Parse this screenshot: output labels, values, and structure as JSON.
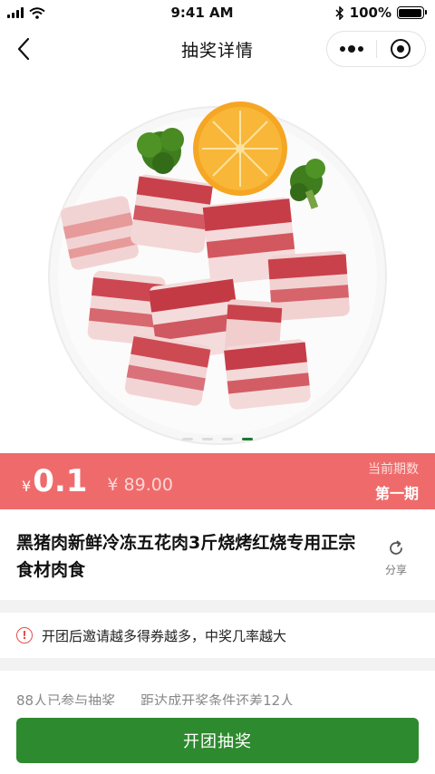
{
  "status_bar": {
    "time": "9:41 AM",
    "battery_text": "100%",
    "battery_level": 1.0
  },
  "nav": {
    "title": "抽奖详情",
    "back_icon": "chevron-left-icon",
    "more_icon": "more-dots-icon",
    "close_icon": "target-circle-icon"
  },
  "hero": {
    "image_subject": "pork-belly-cubes-on-plate",
    "page_count": 4,
    "active_page": 4
  },
  "price_band": {
    "currency": "¥",
    "price": "0.1",
    "original_price": "¥ 89.00",
    "period_label": "当前期数",
    "period_value": "第一期",
    "color": "#ef6b6b"
  },
  "product": {
    "title": "黑猪肉新鲜冷冻五花肉3斤烧烤红烧专用正宗食材肉食",
    "share_label": "分享"
  },
  "notice": {
    "icon": "warning-circle-icon",
    "text": "开团后邀请越多得券越多，中奖几率越大"
  },
  "participants": {
    "joined": "88人已参与抽奖",
    "remaining": "距达成开奖条件还差12人"
  },
  "cta": {
    "label": "开团抽奖",
    "color": "#2e8a2e"
  }
}
